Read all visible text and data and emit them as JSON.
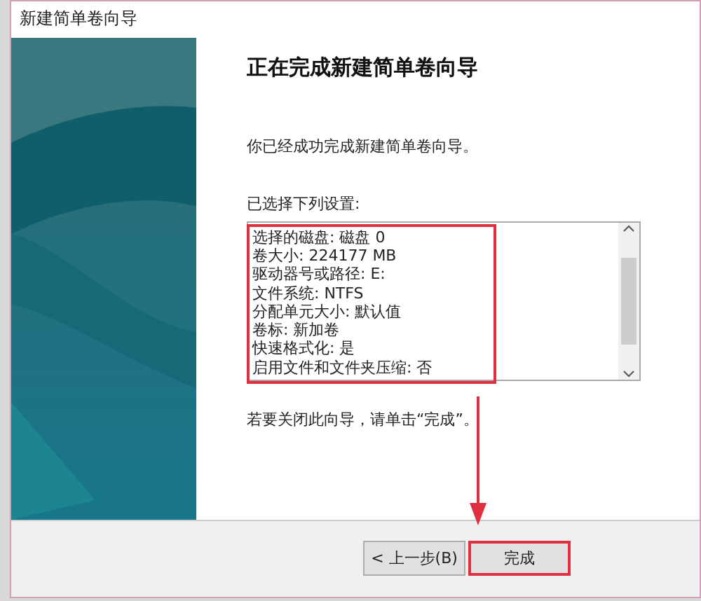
{
  "window": {
    "title": "新建简单卷向导"
  },
  "heading": "正在完成新建简单卷向导",
  "intro": "你已经成功完成新建简单卷向导。",
  "settings_label": "已选择下列设置:",
  "settings": {
    "highlighted": true,
    "lines": [
      "选择的磁盘: 磁盘 0",
      "卷大小: 224177 MB",
      "驱动器号或路径: E:",
      "文件系统: NTFS",
      "分配单元大小: 默认值",
      "卷标: 新加卷",
      "快速格式化: 是",
      "启用文件和文件夹压缩: 否"
    ]
  },
  "closing": "若要关闭此向导，请单击“完成”。",
  "buttons": [
    {
      "label": "< 上一步(B)",
      "highlighted": false
    },
    {
      "label": "完成",
      "highlighted": true
    }
  ]
}
